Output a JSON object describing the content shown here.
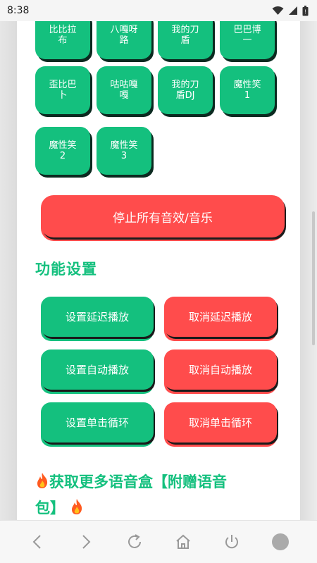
{
  "status_bar": {
    "time": "8:38"
  },
  "sound_buttons": [
    {
      "label": "比比拉\n布"
    },
    {
      "label": "八嘎呀\n路"
    },
    {
      "label": "我的刀\n盾"
    },
    {
      "label": "巴巴博\n一"
    },
    {
      "label": "歪比巴\n卜"
    },
    {
      "label": "咕咕嘎\n嘎"
    },
    {
      "label": "我的刀\n盾DJ"
    },
    {
      "label": "魔性笑\n1"
    },
    {
      "label": "魔性笑\n2"
    },
    {
      "label": "魔性笑\n3"
    }
  ],
  "stop_button": {
    "label": "停止所有音效/音乐"
  },
  "settings": {
    "title": "功能设置",
    "rows": [
      {
        "set": "设置延迟播放",
        "cancel": "取消延迟播放"
      },
      {
        "set": "设置自动播放",
        "cancel": "取消自动播放"
      },
      {
        "set": "设置单击循环",
        "cancel": "取消单击循环"
      }
    ]
  },
  "more": {
    "text_line1": "获取更多语音盒【附赠语音",
    "text_line2": "包】"
  },
  "colors": {
    "green": "#14c07e",
    "red": "#ff4c4c"
  },
  "icons": {
    "status": [
      "wifi-icon",
      "signal-icon",
      "battery-icon"
    ],
    "nav": [
      "back-icon",
      "forward-icon",
      "refresh-icon",
      "home-icon",
      "power-icon",
      "circle-icon"
    ],
    "decor": "fire-icon"
  }
}
